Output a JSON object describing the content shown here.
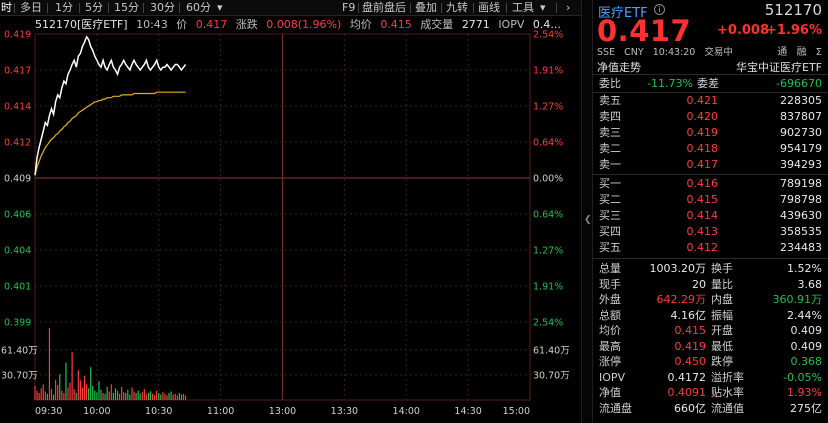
{
  "toolbar": {
    "items": [
      "时",
      "多日",
      "1分",
      "5分",
      "15分",
      "30分",
      "60分"
    ],
    "right_items": [
      "F9",
      "盘前盘后",
      "叠加",
      "九转",
      "画线",
      "工具"
    ],
    "more": "›"
  },
  "chart_head": {
    "code_name": "512170[医疗ETF]",
    "time": "10:43",
    "price_label": "价",
    "price": "0.417",
    "chg_label": "涨跌",
    "chg": "0.008(1.96%)",
    "avg_label": "均价",
    "avg": "0.415",
    "vol_label": "成交量",
    "vol": "2771",
    "iopv_label": "IOPV",
    "iopv": "0.4..."
  },
  "chart_data": {
    "type": "line",
    "x_ticks": [
      "09:30",
      "10:00",
      "10:30",
      "11:00",
      "13:00",
      "13:30",
      "14:00",
      "14:30",
      "15:00"
    ],
    "price_ticks_left": [
      "0.419",
      "0.417",
      "0.414",
      "0.412",
      "0.409",
      "0.406",
      "0.404",
      "0.401",
      "0.399"
    ],
    "pct_ticks_right": [
      "2.54%",
      "1.91%",
      "1.27%",
      "0.64%",
      "0.00%",
      "0.64%",
      "1.27%",
      "1.91%",
      "2.54%"
    ],
    "volume_ticks_left": [
      "61.40万",
      "30.70万"
    ],
    "volume_ticks_right": [
      "61.40万",
      "30.70万"
    ],
    "prev_close": 0.409,
    "price_range": [
      0.3986,
      0.4194
    ],
    "volume_max": 921000,
    "series": [
      {
        "values": [
          0.4092,
          0.4105,
          0.4112,
          0.4118,
          0.4124,
          0.413,
          0.4128,
          0.4135,
          0.414,
          0.4136,
          0.4145,
          0.415,
          0.4148,
          0.4155,
          0.416,
          0.4158,
          0.4165,
          0.4168,
          0.4172,
          0.4175,
          0.417,
          0.4178,
          0.418,
          0.4185,
          0.4188,
          0.4192,
          0.419,
          0.4185,
          0.4182,
          0.4178,
          0.4175,
          0.4172,
          0.417,
          0.4175,
          0.417,
          0.4168,
          0.4172,
          0.4175,
          0.417,
          0.4168,
          0.4165,
          0.417,
          0.4172,
          0.4175,
          0.4172,
          0.417,
          0.4168,
          0.4172,
          0.4175,
          0.4172,
          0.417,
          0.4168,
          0.417,
          0.4172,
          0.4175,
          0.417,
          0.4168,
          0.417,
          0.4172,
          0.4175,
          0.417,
          0.4168,
          0.417,
          0.417,
          0.4172,
          0.417,
          0.4168,
          0.417,
          0.4172,
          0.4172,
          0.417,
          0.4168,
          0.417,
          0.4172
        ]
      },
      {
        "values": [
          0.4092,
          0.4098,
          0.4102,
          0.4106,
          0.4109,
          0.4112,
          0.4114,
          0.4116,
          0.4118,
          0.4119,
          0.4121,
          0.4122,
          0.4124,
          0.4125,
          0.4127,
          0.4128,
          0.413,
          0.4131,
          0.4133,
          0.4134,
          0.4135,
          0.4137,
          0.4138,
          0.4139,
          0.414,
          0.4141,
          0.4142,
          0.4143,
          0.4144,
          0.4145,
          0.4145,
          0.4146,
          0.4146,
          0.4147,
          0.4147,
          0.4148,
          0.4148,
          0.4148,
          0.4149,
          0.4149,
          0.4149,
          0.4149,
          0.415,
          0.415,
          0.415,
          0.415,
          0.415,
          0.415,
          0.4151,
          0.4151,
          0.4151,
          0.4151,
          0.4151,
          0.4151,
          0.4151,
          0.4151,
          0.4151,
          0.4151,
          0.4151,
          0.4152,
          0.4152,
          0.4152,
          0.4152,
          0.4152,
          0.4152,
          0.4152,
          0.4152,
          0.4152,
          0.4152,
          0.4152,
          0.4152,
          0.4152,
          0.4152,
          0.4152
        ]
      }
    ],
    "volumes": [
      180000,
      120000,
      90000,
      150000,
      200000,
      110000,
      80000,
      921000,
      140000,
      70000,
      260000,
      190000,
      330000,
      120000,
      90000,
      480000,
      160000,
      220000,
      610000,
      140000,
      90000,
      380000,
      250000,
      160000,
      310000,
      200000,
      150000,
      420000,
      180000,
      120000,
      100000,
      240000,
      130000,
      90000,
      80000,
      170000,
      110000,
      200000,
      90000,
      150000,
      120000,
      80000,
      170000,
      100000,
      90000,
      130000,
      70000,
      160000,
      110000,
      90000,
      120000,
      80000,
      100000,
      140000,
      70000,
      90000,
      110000,
      80000,
      60000,
      120000,
      90000,
      70000,
      100000,
      80000,
      60000,
      90000,
      110000,
      70000,
      80000,
      60000,
      90000,
      70000,
      80000,
      60000
    ],
    "colors": {
      "price": "#ffffff",
      "avg": "#e0b020",
      "up": "#ff3b3b",
      "down": "#20c050",
      "grid": "#3a2020"
    }
  },
  "panel": {
    "name": "医疗ETF",
    "code": "512170",
    "price": "0.417",
    "chg": "+0.008",
    "pct": "+1.96%",
    "meta": [
      "SSE",
      "CNY",
      "10:43:20",
      "交易中"
    ],
    "icons": [
      "通",
      "融",
      "Σ"
    ],
    "nav_label": "净值走势",
    "index_name": "华宝中证医疗ETF",
    "wb": {
      "label1": "委比",
      "val1": "-11.73%",
      "label2": "委差",
      "val2": "-696670"
    },
    "asks": [
      {
        "label": "卖五",
        "price": "0.421",
        "vol": "228305"
      },
      {
        "label": "卖四",
        "price": "0.420",
        "vol": "837807"
      },
      {
        "label": "卖三",
        "price": "0.419",
        "vol": "902730"
      },
      {
        "label": "卖二",
        "price": "0.418",
        "vol": "954179"
      },
      {
        "label": "卖一",
        "price": "0.417",
        "vol": "394293"
      }
    ],
    "bids": [
      {
        "label": "买一",
        "price": "0.416",
        "vol": "789198"
      },
      {
        "label": "买二",
        "price": "0.415",
        "vol": "798798"
      },
      {
        "label": "买三",
        "price": "0.414",
        "vol": "439630"
      },
      {
        "label": "买四",
        "price": "0.413",
        "vol": "358535"
      },
      {
        "label": "买五",
        "price": "0.412",
        "vol": "234483"
      }
    ],
    "stats": [
      {
        "l1": "总量",
        "v1": "1003.20万",
        "c1": "w",
        "l2": "换手",
        "v2": "1.52%",
        "c2": "w"
      },
      {
        "l1": "现手",
        "v1": "20",
        "c1": "w",
        "l2": "量比",
        "v2": "3.68",
        "c2": "w"
      },
      {
        "l1": "外盘",
        "v1": "642.29万",
        "c1": "r",
        "l2": "内盘",
        "v2": "360.91万",
        "c2": "g"
      },
      {
        "l1": "总额",
        "v1": "4.16亿",
        "c1": "w",
        "l2": "振幅",
        "v2": "2.44%",
        "c2": "w"
      },
      {
        "l1": "均价",
        "v1": "0.415",
        "c1": "r",
        "l2": "开盘",
        "v2": "0.409",
        "c2": "w"
      },
      {
        "l1": "最高",
        "v1": "0.419",
        "c1": "r",
        "l2": "最低",
        "v2": "0.409",
        "c2": "w"
      },
      {
        "l1": "涨停",
        "v1": "0.450",
        "c1": "r",
        "l2": "跌停",
        "v2": "0.368",
        "c2": "g"
      },
      {
        "l1": "IOPV",
        "v1": "0.4172",
        "c1": "w",
        "l2": "溢折率",
        "v2": "-0.05%",
        "c2": "g"
      },
      {
        "l1": "净值",
        "v1": "0.4091",
        "c1": "r",
        "l2": "贴水率",
        "v2": "1.93%",
        "c2": "r"
      },
      {
        "l1": "流通盘",
        "v1": "660亿",
        "c1": "w",
        "l2": "流通值",
        "v2": "275亿",
        "c2": "w"
      }
    ]
  }
}
